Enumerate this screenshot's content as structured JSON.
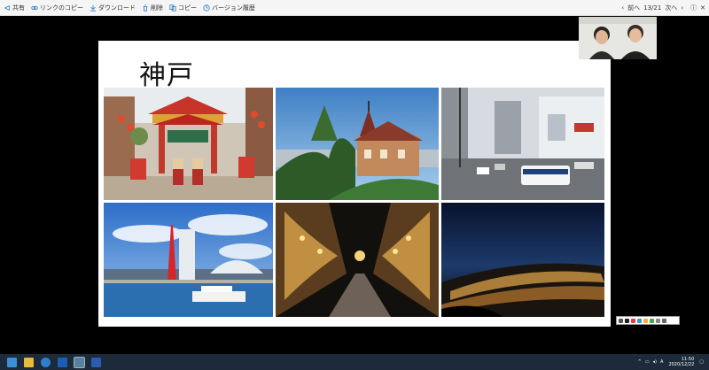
{
  "toolbar": {
    "items": [
      {
        "label": "共有",
        "icon": "share-icon"
      },
      {
        "label": "リンクのコピー",
        "icon": "link-icon"
      },
      {
        "label": "ダウンロード",
        "icon": "download-icon"
      },
      {
        "label": "削除",
        "icon": "trash-icon"
      },
      {
        "label": "コピー",
        "icon": "copy-icon"
      },
      {
        "label": "バージョン履歴",
        "icon": "version-history-icon"
      }
    ],
    "prev_label": "前へ",
    "page": "13/21",
    "next_label": "次へ"
  },
  "slide": {
    "title": "神戸"
  },
  "taskbar": {
    "lang": "A",
    "time": "11:50",
    "date": "2020/12/22"
  },
  "colors": {
    "toolbar_bg": "#f5f5f5",
    "toolbar_accent": "#2b78c5",
    "taskbar_bg": "#1c2a3a"
  }
}
